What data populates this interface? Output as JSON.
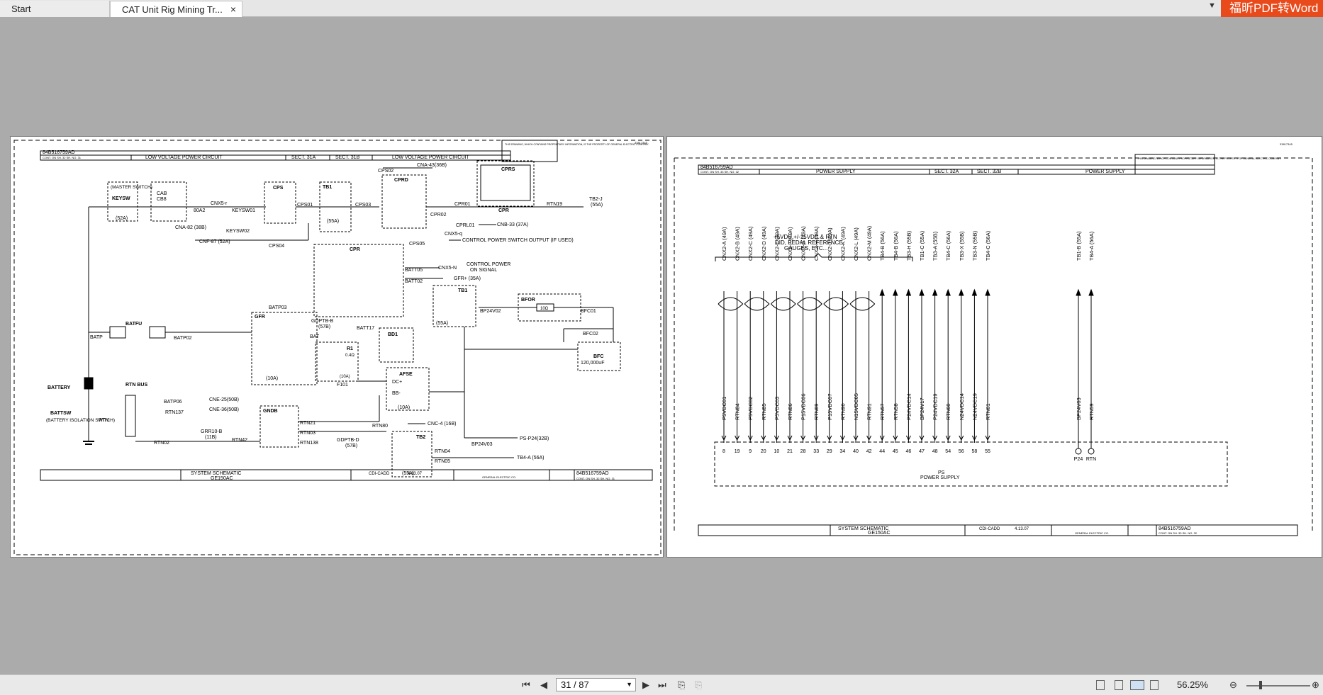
{
  "tabs": [
    {
      "label": "Start"
    },
    {
      "label": "CAT Unit Rig Mining Tr...",
      "close": "×"
    }
  ],
  "brand": "福昕PDF转Word",
  "navigation": {
    "page_value": "31 / 87",
    "zoom": "56.25%"
  },
  "page1": {
    "doc_number": "84B516759AD",
    "sheet_line": "CONT. ON SH. 32  SH. NO. 31",
    "title_left": "LOW VOLTAGE POWER CIRCUIT",
    "sect_a": "SECT. 31A",
    "sect_b": "SECT. 31B",
    "title_right": "LOW VOLTAGE POWER CIRCUIT",
    "notice": "THIS DRAWING, WHICH CONTAINS PROPRIETARY INFORMATION, IS THE PROPERTY OF GENERAL ELECTRIC COMPANY.",
    "corner_number": "33817345",
    "footer_title": "SYSTEM SCHEMATIC",
    "footer_first_made": "GE150AC",
    "footer_made_by": "CDI-CADD",
    "footer_date": "4.13.07",
    "footer_control": "GENERAL ELECTRIC CO.",
    "footer_doc": "84B516759AD",
    "footer_sheet": "CONT. ON SH. 32  SH. NO. 31",
    "labels": {
      "master": "(MASTER SWITCH)",
      "keysw": "KEYSW",
      "keysw_a": "(52A)",
      "cab": "CAB",
      "cb8": "CB8",
      "cnx5r": "CNX5-r",
      "a80": "80A2",
      "keysw01": "KEYSW01",
      "cps": "CPS",
      "tb1": "TB1",
      "tb1a": "(55A)",
      "cps01": "CPS01",
      "cps03": "CPS03",
      "cps02": "CPS02",
      "cna43": "CNA-43(36B)",
      "cprd": "CPRD",
      "cprs": "CPRS",
      "cpr01": "CPR01",
      "cpr02": "CPR02",
      "rtn19": "RTN19",
      "tb2j": "TB2-J",
      "tb2ja": "(55A)",
      "cpr": "CPR",
      "cprl01": "CPRL01",
      "cnb33": "CNB-33 (37A)",
      "cnx5q": "CNX5-q",
      "cpsout": "CONTROL POWER SWITCH OUTPUT (IF USED)",
      "cps05": "CPS05",
      "cna82": "CNA-82 (38B)",
      "keysw02": "KEYSW02",
      "cnf87": "CNF-87 (52A)",
      "cps04": "CPS04",
      "batt05": "BATT05",
      "cnx5n": "CNX5-N",
      "ctrlpower": "CONTROL POWER",
      "onsignal": "ON SIGNAL",
      "batt02": "BATT02",
      "gfrplus": "GFR+ (35A)",
      "batp03": "BATP03",
      "gfr": "GFR",
      "batfu": "BATFU",
      "batp": "BATP",
      "batp02": "BATP02",
      "bfor": "BFOR",
      "r10": "10Ω",
      "bp24v02": "BP24V02",
      "bfc01": "BFC01",
      "bfc02": "BFC02",
      "bfc": "BFC",
      "bfcval": "120,000uF",
      "gdptbb": "GDPTB-B",
      "b57": "(57B)",
      "batt17": "BATT17",
      "batt01": "BATT01",
      "bat": "BAT",
      "bd1": "BD1",
      "r1": "R1",
      "r1v": "0.4Ω",
      "a10": "(10A)",
      "f101": "F101",
      "afse": "AFSE",
      "dcp": "DC+",
      "bbm": "BB-",
      "battery": "BATTERY",
      "battsw": "BATTSW",
      "battsw_desc": "(BATTERY ISOLATION SWITCH)",
      "rtn": "RTN",
      "rtnbus": "RTN BUS",
      "batp06": "BATP06",
      "rtn137": "RTN137",
      "cne25": "CNE-25(50B)",
      "cne36": "CNE-36(50B)",
      "gndb": "GNDB",
      "rtn21": "RTN21",
      "rtn03": "RTN03",
      "rtn138": "RTN138",
      "grr10b": "GRR10-B",
      "b11": "(11B)",
      "rtn42": "RTN42",
      "rtn02": "RTN02",
      "gdptbd": "GDPTB-D",
      "rtn80": "RTN80",
      "cnc4": "CNC-4 (16B)",
      "tb2": "TB2",
      "rtn04": "RTN04",
      "rtn05": "RTN05",
      "bp24v03": "BP24V03",
      "psp24": "PS-P24(32B)",
      "tb4a": "TB4-A (56A)"
    }
  },
  "page2": {
    "doc_number": "84B516759AD",
    "sheet_line": "CONT. ON SH. 33  SH. NO. 32",
    "title_left": "POWER SUPPLY",
    "sect_a": "SECT. 32A",
    "sect_b": "SECT. 32B",
    "title_right": "POWER SUPPLY",
    "notice": "THIS DRAWING, WHICH CONTAINS PROPRIETARY INFORMATION, IS THE PROPERTY OF GENERAL ELECTRIC COMPANY.",
    "corner_number": "33817345",
    "brace_label_1": "+5VDC,+/-15VDC & RTN",
    "brace_label_2": "DID, PEDAL REFERENCE,",
    "brace_label_3": "GAUGES, ETC...",
    "ps_label": "PS",
    "ps_desc": "POWER SUPPLY",
    "footer_title": "SYSTEM SCHEMATIC",
    "footer_first_made": "GE150AC",
    "footer_made_by": "CDI-CADD",
    "footer_date": "4.13.07",
    "footer_control": "GENERAL ELECTRIC CO.",
    "footer_doc": "84B516759AD",
    "footer_sheet": "CONT. ON SH. 33  SH. NO. 32",
    "wires": [
      {
        "top": "CNX2-A (49A)",
        "bottom": "P5VDC01",
        "pin": "8"
      },
      {
        "top": "CNX2-B (49A)",
        "bottom": "RTN84",
        "pin": "19"
      },
      {
        "top": "CNX2-C (49A)",
        "bottom": "P5VDC02",
        "pin": "9"
      },
      {
        "top": "CNX2-D (49A)",
        "bottom": "RTN85",
        "pin": "20"
      },
      {
        "top": "CNX2-E (49A)",
        "bottom": "P5VDC03",
        "pin": "10"
      },
      {
        "top": "CNX2-F (49A)",
        "bottom": "RTN86",
        "pin": "21"
      },
      {
        "top": "CNX2-G (49A)",
        "bottom": "P15VDC06",
        "pin": "28"
      },
      {
        "top": "CNX2-H (49A)",
        "bottom": "RTN89",
        "pin": "33"
      },
      {
        "top": "CNX2-J (49A)",
        "bottom": "P15VDC07",
        "pin": "29"
      },
      {
        "top": "CNX2-K (49A)",
        "bottom": "RTN90",
        "pin": "34"
      },
      {
        "top": "CNX2-L (49A)",
        "bottom": "N15VDC05",
        "pin": "40"
      },
      {
        "top": "CNX2-M (49A)",
        "bottom": "RTN91",
        "pin": "42"
      },
      {
        "top": "TB4-B (56A)",
        "bottom": "RTN57",
        "pin": "44"
      },
      {
        "top": "TB4-B (56A)",
        "bottom": "RTN58",
        "pin": "45"
      },
      {
        "top": "TB3-H (55B)",
        "bottom": "P24VDC14",
        "pin": "46"
      },
      {
        "top": "TB1-C (55A)",
        "bottom": "BP24V17",
        "pin": "47"
      },
      {
        "top": "TB3-A (55B)",
        "bottom": "P24VDC19",
        "pin": "48"
      },
      {
        "top": "TB4-C (56A)",
        "bottom": "RTN60",
        "pin": "54"
      },
      {
        "top": "TB3-X (55B)",
        "bottom": "N24VDC14",
        "pin": "56"
      },
      {
        "top": "TB3-N (55B)",
        "bottom": "N24VDC19",
        "pin": "58"
      },
      {
        "top": "TB4-C (56A)",
        "bottom": "RTN61",
        "pin": "55"
      }
    ],
    "right_wires": [
      {
        "top": "TB1-B (55A)",
        "bottom": "BP24V03",
        "pin": "P24"
      },
      {
        "top": "TB4-A (56A)",
        "bottom": "RTN59",
        "pin": "RTN"
      }
    ]
  },
  "colors": {
    "brand": "#e84a1c",
    "background": "#ababab",
    "ink": "#000000"
  }
}
